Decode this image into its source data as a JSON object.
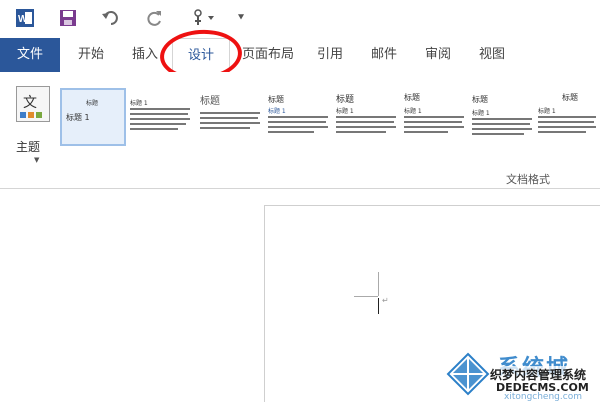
{
  "tabs": [
    {
      "label": "文件"
    },
    {
      "label": "开始"
    },
    {
      "label": "插入"
    },
    {
      "label": "设计"
    },
    {
      "label": "页面布局"
    },
    {
      "label": "引用"
    },
    {
      "label": "邮件"
    },
    {
      "label": "审阅"
    },
    {
      "label": "视图"
    }
  ],
  "ribbon": {
    "theme_label": "主题",
    "theme_icon_text": "文",
    "group_label": "文档格式",
    "samples": [
      {
        "title": "标题",
        "heading": "标题 1"
      },
      {
        "title": "",
        "heading": "标题 1"
      },
      {
        "title": "标题",
        "heading": ""
      },
      {
        "title": "标题",
        "heading": "标题 1"
      },
      {
        "title": "标题",
        "heading": "标题 1"
      },
      {
        "title": "标题",
        "heading": "标题 1"
      },
      {
        "title": "标题",
        "heading": "标题 1"
      },
      {
        "title": "标题",
        "heading": "标题 1"
      }
    ]
  },
  "watermark": {
    "main": "系统城",
    "line1": "织梦内容管理系统",
    "line2": "DEDECMS.COM",
    "line3": "xitongcheng.com"
  },
  "colors": {
    "accent": "#2b579a",
    "highlight_circle": "#ee1111"
  }
}
